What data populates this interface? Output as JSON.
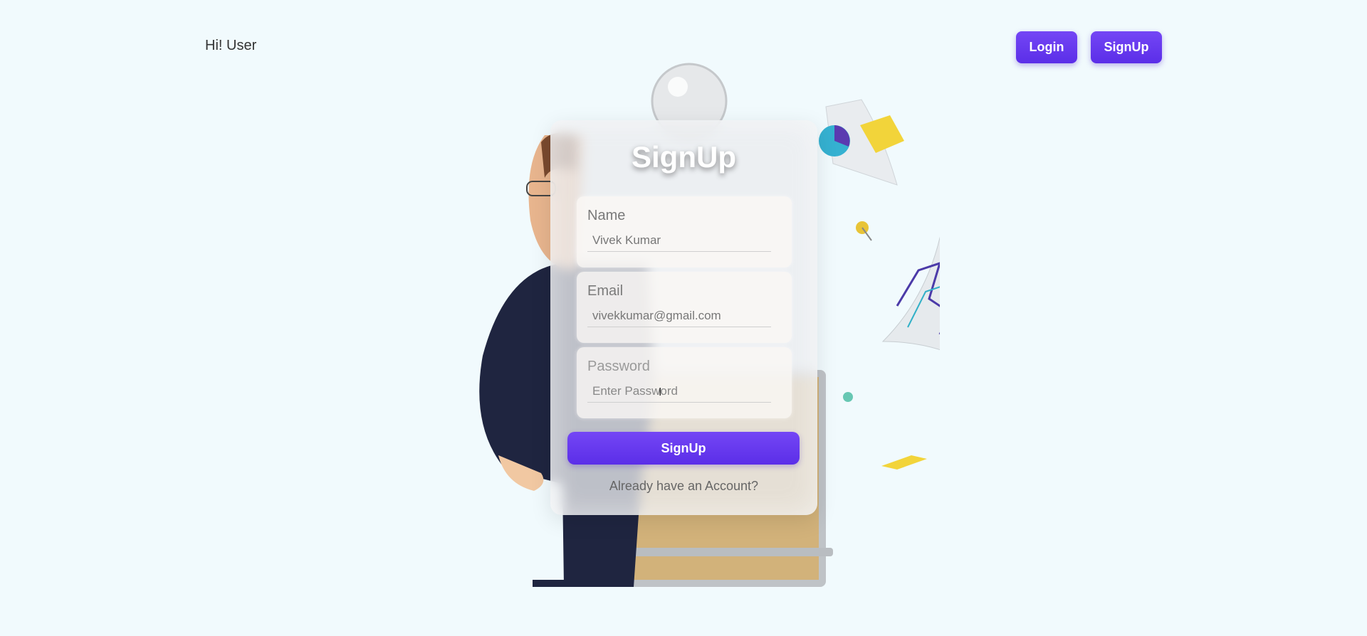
{
  "header": {
    "greeting": "Hi! User",
    "login_label": "Login",
    "signup_label": "SignUp"
  },
  "form": {
    "title": "SignUp",
    "name": {
      "label": "Name",
      "value": "Vivek Kumar",
      "placeholder": ""
    },
    "email": {
      "label": "Email",
      "value": "vivekkumar@gmail.com",
      "placeholder": ""
    },
    "password": {
      "label": "Password",
      "value": "",
      "placeholder": "Enter Password"
    },
    "submit_label": "SignUp",
    "account_link": "Already have an Account?"
  },
  "colors": {
    "accent": "#6a3df0",
    "background": "#f1fafd",
    "card": "#ebecee"
  },
  "icons": {
    "cursor": "text-cursor-icon"
  }
}
